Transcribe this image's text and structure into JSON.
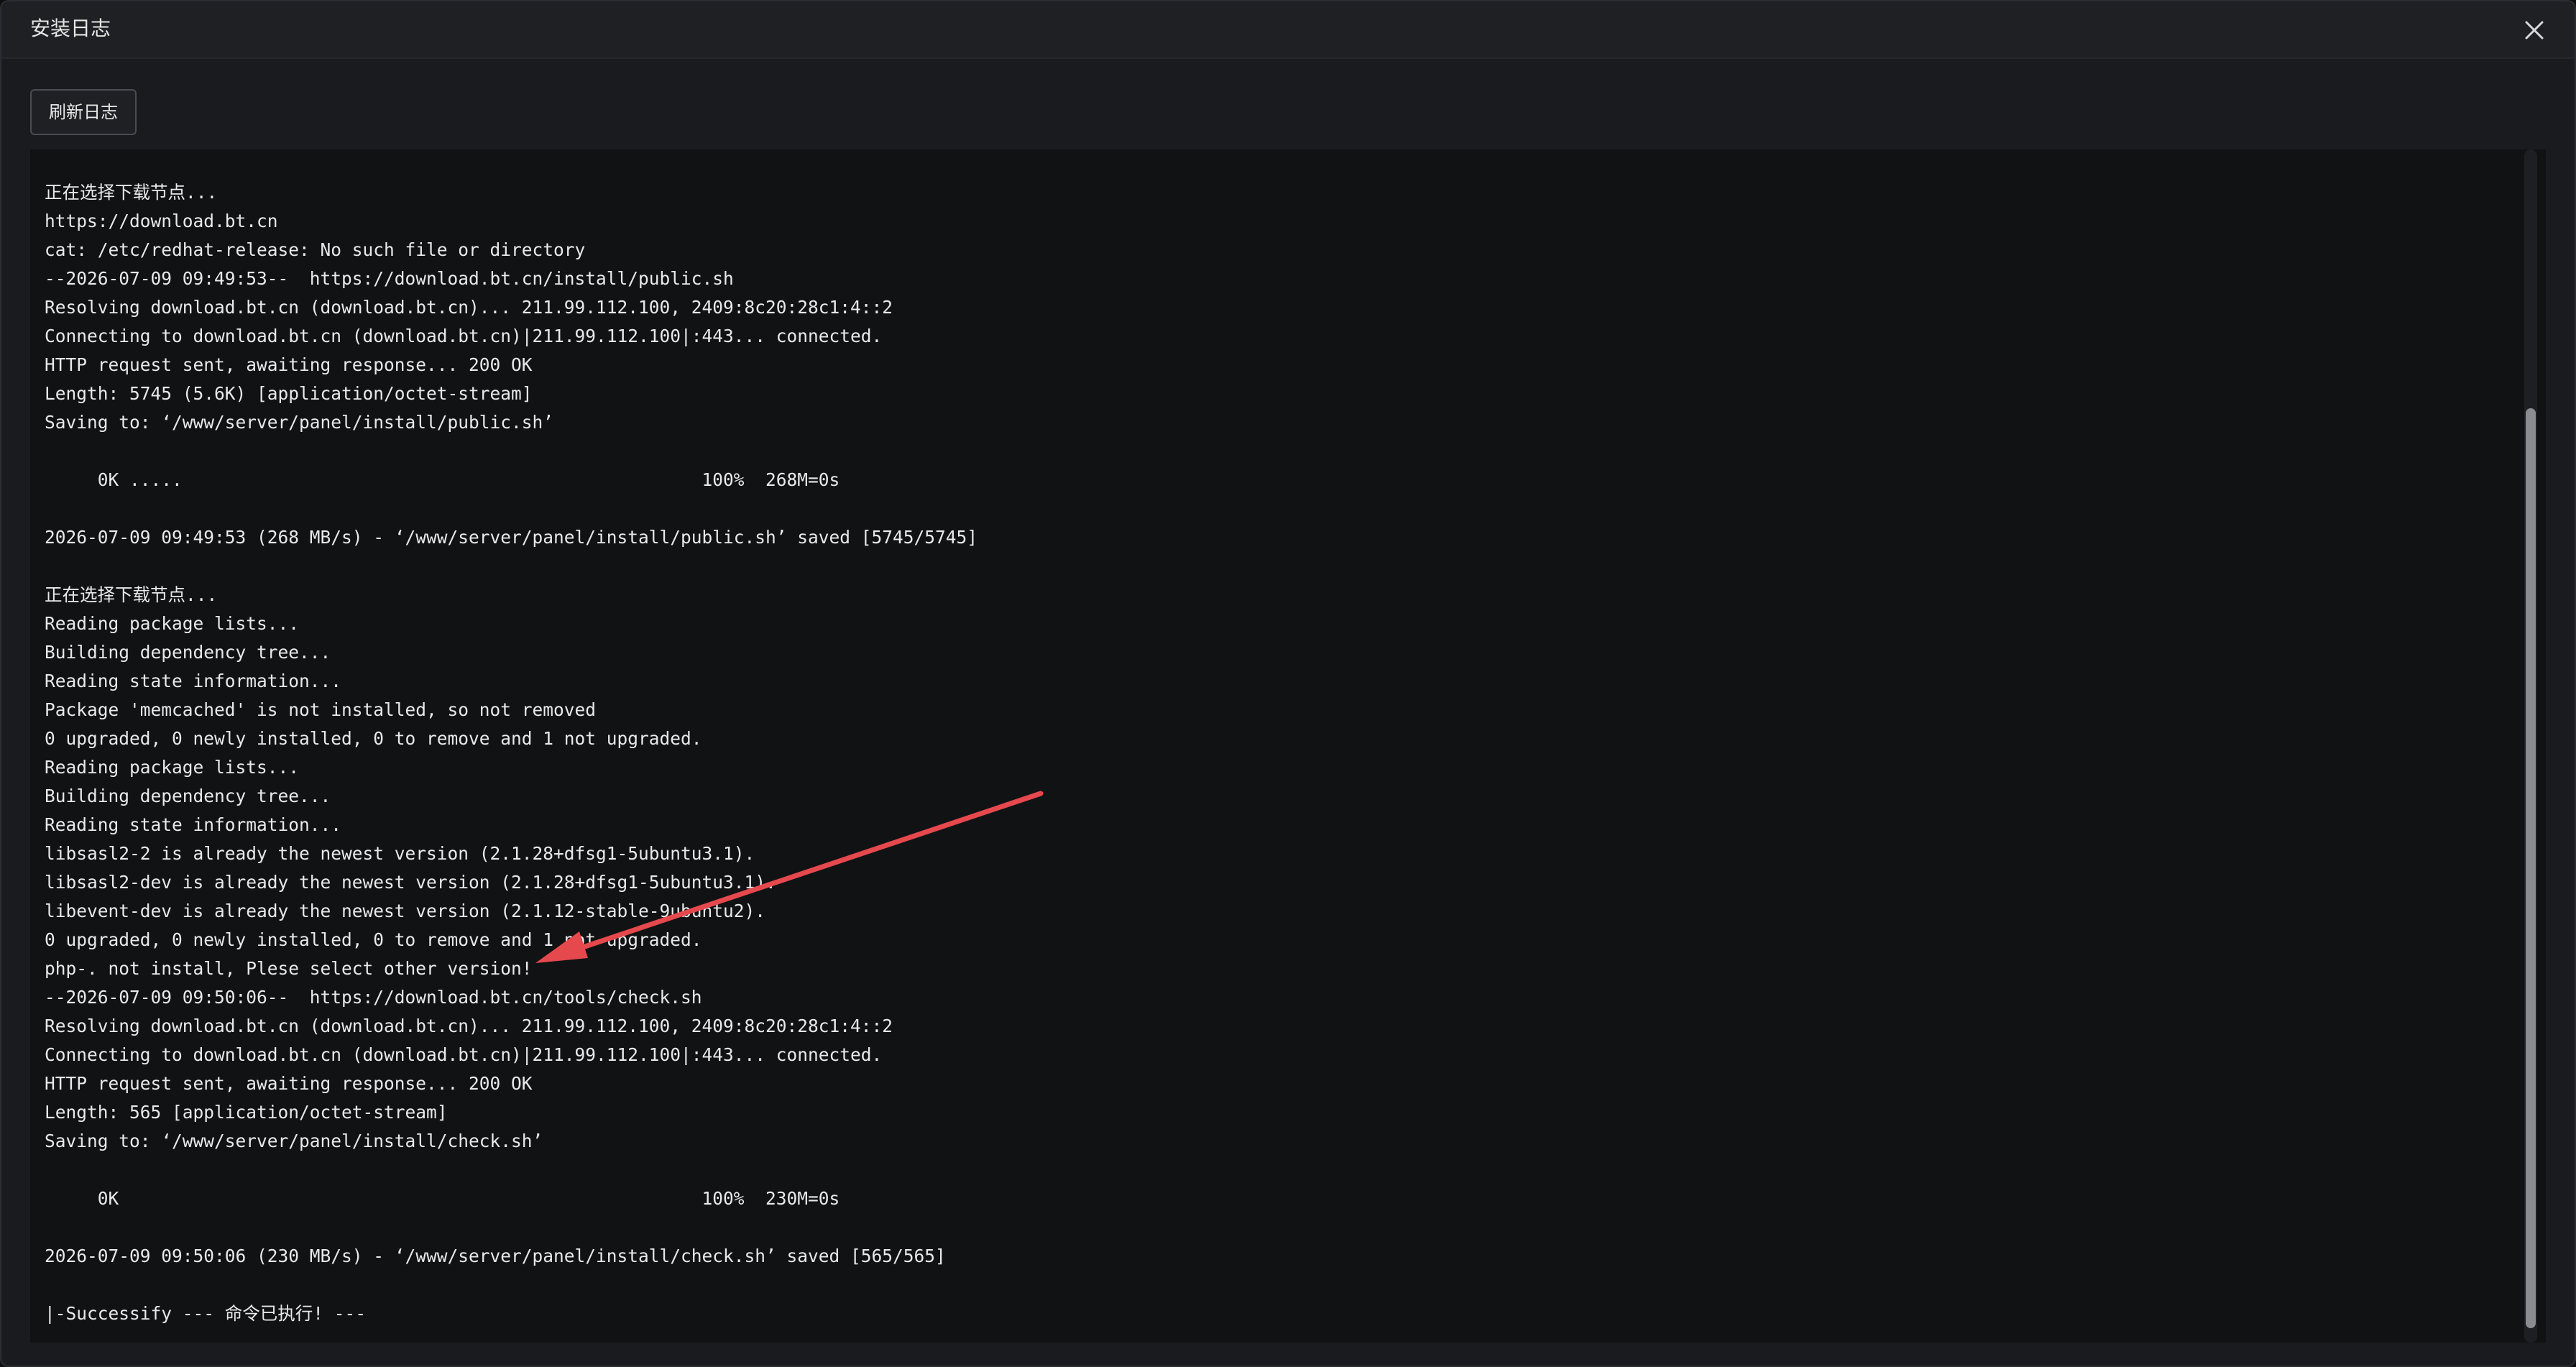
{
  "dialog": {
    "title": "安装日志",
    "close_icon": "close-icon"
  },
  "toolbar": {
    "refresh_label": "刷新日志"
  },
  "log": {
    "lines": [
      "正在选择下载节点...",
      "https://download.bt.cn",
      "cat: /etc/redhat-release: No such file or directory",
      "--2026-07-09 09:49:53--  https://download.bt.cn/install/public.sh",
      "Resolving download.bt.cn (download.bt.cn)... 211.99.112.100, 2409:8c20:28c1:4::2",
      "Connecting to download.bt.cn (download.bt.cn)|211.99.112.100|:443... connected.",
      "HTTP request sent, awaiting response... 200 OK",
      "Length: 5745 (5.6K) [application/octet-stream]",
      "Saving to: ‘/www/server/panel/install/public.sh’",
      "",
      "     0K .....                                                 100%  268M=0s",
      "",
      "2026-07-09 09:49:53 (268 MB/s) - ‘/www/server/panel/install/public.sh’ saved [5745/5745]",
      "",
      "正在选择下载节点...",
      "Reading package lists...",
      "Building dependency tree...",
      "Reading state information...",
      "Package 'memcached' is not installed, so not removed",
      "0 upgraded, 0 newly installed, 0 to remove and 1 not upgraded.",
      "Reading package lists...",
      "Building dependency tree...",
      "Reading state information...",
      "libsasl2-2 is already the newest version (2.1.28+dfsg1-5ubuntu3.1).",
      "libsasl2-dev is already the newest version (2.1.28+dfsg1-5ubuntu3.1).",
      "libevent-dev is already the newest version (2.1.12-stable-9ubuntu2).",
      "0 upgraded, 0 newly installed, 0 to remove and 1 not upgraded.",
      "php-. not install, Plese select other version!",
      "--2026-07-09 09:50:06--  https://download.bt.cn/tools/check.sh",
      "Resolving download.bt.cn (download.bt.cn)... 211.99.112.100, 2409:8c20:28c1:4::2",
      "Connecting to download.bt.cn (download.bt.cn)|211.99.112.100|:443... connected.",
      "HTTP request sent, awaiting response... 200 OK",
      "Length: 565 [application/octet-stream]",
      "Saving to: ‘/www/server/panel/install/check.sh’",
      "",
      "     0K                                                       100%  230M=0s",
      "",
      "2026-07-09 09:50:06 (230 MB/s) - ‘/www/server/panel/install/check.sh’ saved [565/565]",
      "",
      "|-Successify --- 命令已执行! ---"
    ]
  },
  "annotation": {
    "arrow_color": "#e5484d"
  }
}
